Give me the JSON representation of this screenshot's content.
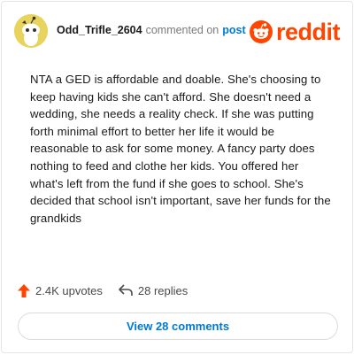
{
  "header": {
    "username": "Odd_Trifle_2604",
    "action_text": "commented on",
    "post_link": "post",
    "brand": "reddit"
  },
  "comment": {
    "body": "NTA a GED is affordable and doable. She's choosing to keep having kids she can't afford. She doesn't need a wedding, she needs a reality check. If she was putting forth minimal effort to better her life it would be reasonable to ask for some money. A fancy party does nothing to feed and clothe her kids. You offered her what's left from the fund if she goes to school. She's decided that school isn't important, save her funds for the grandkids"
  },
  "actions": {
    "upvotes": "2.4K upvotes",
    "replies": "28 replies"
  },
  "footer": {
    "view_button": "View 28 comments"
  },
  "colors": {
    "brand": "#ff4500",
    "link": "#0079d3",
    "avatar": "#e8d45c"
  },
  "icons": {
    "avatar": "snoo-avatar-icon",
    "logo": "reddit-snoo-icon",
    "upvote": "upvote-arrow-icon",
    "reply": "reply-arrow-icon"
  }
}
